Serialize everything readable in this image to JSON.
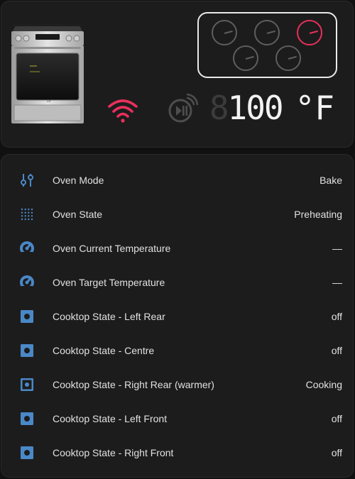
{
  "colors": {
    "background": "#111111",
    "card": "#1c1c1c",
    "accent_active": "#e8305c",
    "icon_blue": "#4a88c7",
    "inactive": "#5e5e5e"
  },
  "status_icons": {
    "wifi": "wifi-icon",
    "remote": "remote-start-icon"
  },
  "cooktop_burners": [
    {
      "position": "left-rear",
      "state": "off"
    },
    {
      "position": "centre",
      "state": "off"
    },
    {
      "position": "right-rear",
      "state": "on"
    },
    {
      "position": "left-front",
      "state": "off"
    },
    {
      "position": "right-front",
      "state": "off"
    }
  ],
  "display": {
    "ghost_digit": "8",
    "temperature": "100",
    "unit": "°F"
  },
  "entities": [
    {
      "label": "Oven Mode",
      "value": "Bake",
      "icon": "tune-vertical-icon"
    },
    {
      "label": "Oven State",
      "value": "Preheating",
      "icon": "dots-grid-icon"
    },
    {
      "label": "Oven Current Temperature",
      "value": "—",
      "icon": "gauge-icon"
    },
    {
      "label": "Oven Target Temperature",
      "value": "—",
      "icon": "gauge-icon"
    },
    {
      "label": "Cooktop State - Left Rear",
      "value": "off",
      "icon": "burner-icon"
    },
    {
      "label": "Cooktop State - Centre",
      "value": "off",
      "icon": "burner-icon"
    },
    {
      "label": "Cooktop State - Right Rear (warmer)",
      "value": "Cooking",
      "icon": "burner-icon"
    },
    {
      "label": "Cooktop State - Left Front",
      "value": "off",
      "icon": "burner-icon"
    },
    {
      "label": "Cooktop State - Right Front",
      "value": "off",
      "icon": "burner-icon"
    }
  ]
}
